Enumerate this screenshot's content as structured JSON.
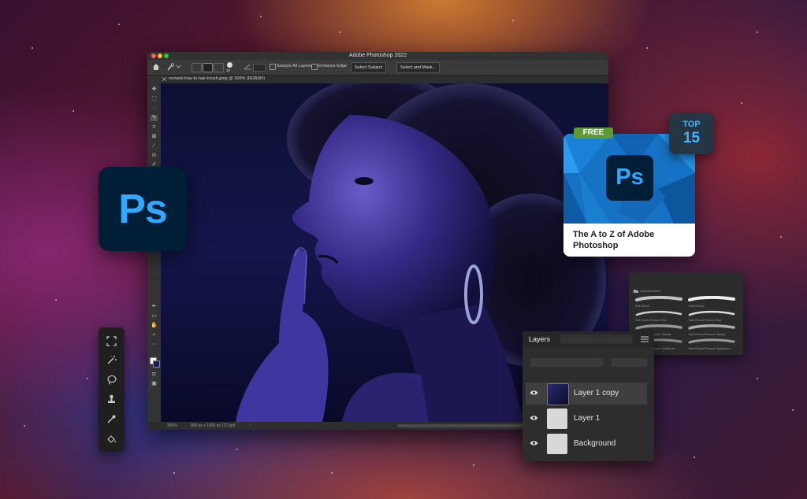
{
  "app": {
    "window_title": "Adobe Photoshop 2022",
    "document_tab": "revised-how-to-hair-brush.jpeg @ 300% (RGB/8#)",
    "status_zoom": "300%",
    "status_doc": "800 px x 1069 px (72 ppi)"
  },
  "options_bar": {
    "brush_size": "30",
    "sample_all_layers": "Sample All Layers",
    "enhance_edge": "Enhance Edge",
    "select_subject": "Select Subject",
    "select_and_mask": "Select and Mask..."
  },
  "ps_logo_text": "Ps",
  "course_card": {
    "badge": "FREE",
    "logo_text": "Ps",
    "title": "The A to Z of Adobe Photoshop",
    "rank_top": "TOP",
    "rank_number": "15"
  },
  "brushes_panel": {
    "group": "General Brushes",
    "brushes": [
      "Soft Round",
      "Hard Round",
      "Soft Round Pressure Size",
      "Hard Round Pressure Size",
      "Soft Round Pressure Opacity",
      "Hard Round Pressure Opacity",
      "Soft Round Pressure Opacity an...",
      "Hard Round Pressure Opacity an..."
    ]
  },
  "layers_panel": {
    "title": "Layers",
    "layers": [
      {
        "name": "Layer 1 copy",
        "selected": true
      },
      {
        "name": "Layer 1",
        "selected": false
      },
      {
        "name": "Background",
        "selected": false
      }
    ]
  },
  "colors": {
    "ps_blue": "#31a8ff",
    "ps_navy": "#001e36",
    "free_green": "#5c9b32"
  }
}
